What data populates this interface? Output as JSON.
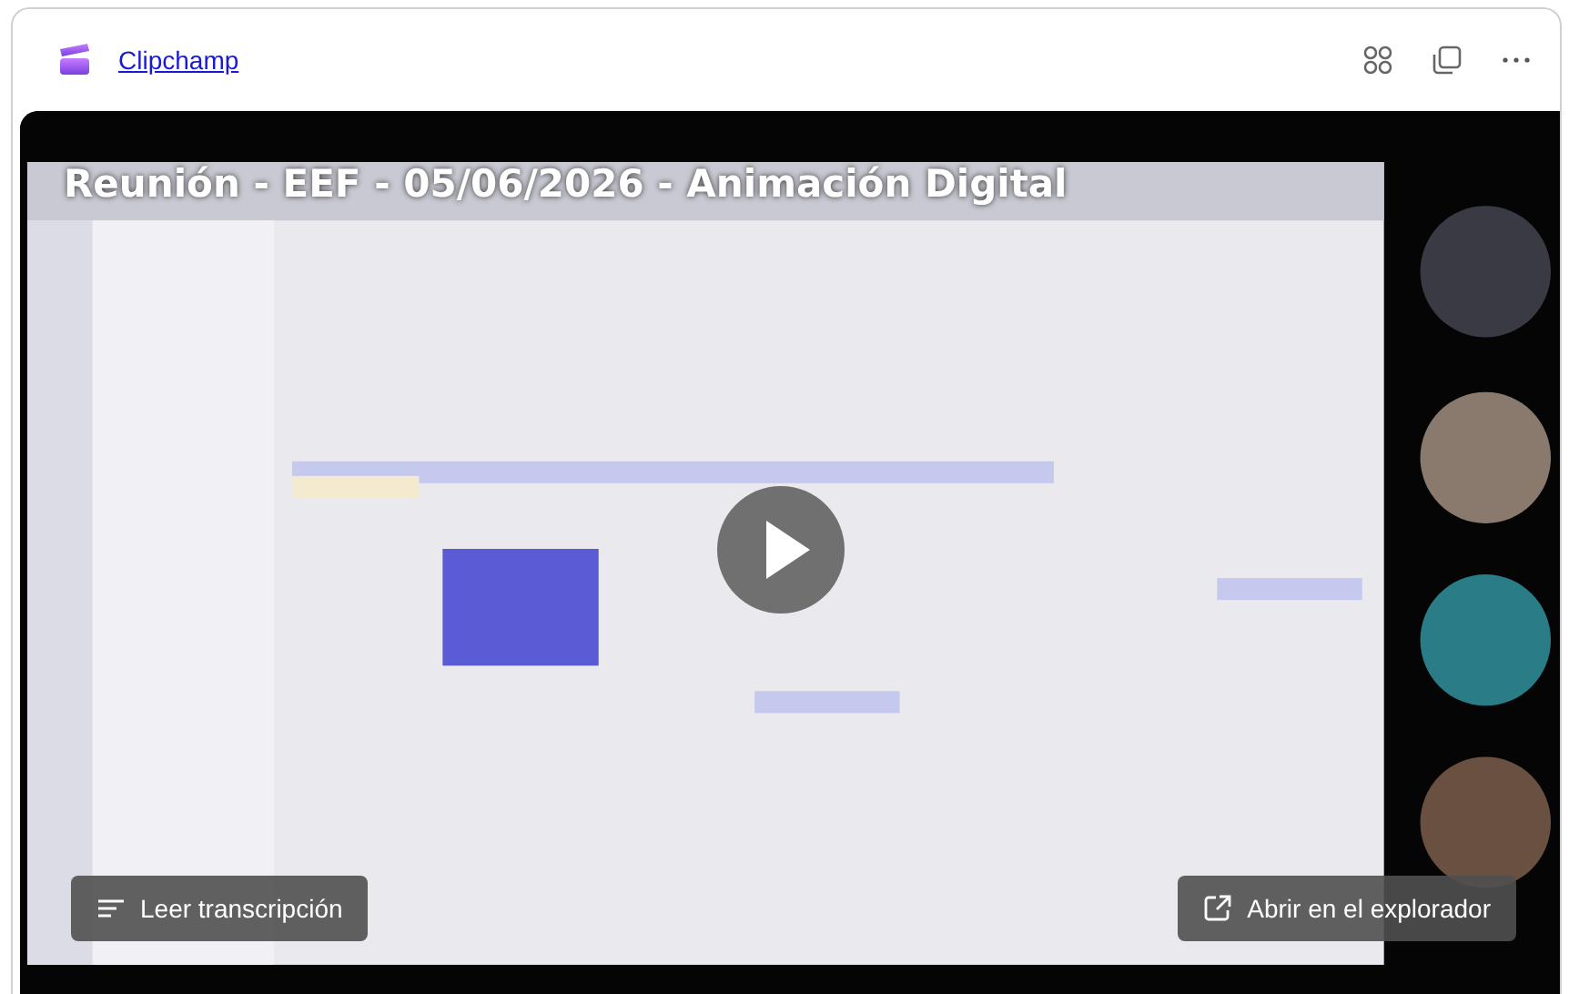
{
  "app": {
    "name": "Clipchamp"
  },
  "video": {
    "title": "Reunión - EEF - 05/06/2026 - Animación Digital",
    "transcript_button": "Leer transcripción",
    "open_button": "Abrir en el explorador"
  }
}
